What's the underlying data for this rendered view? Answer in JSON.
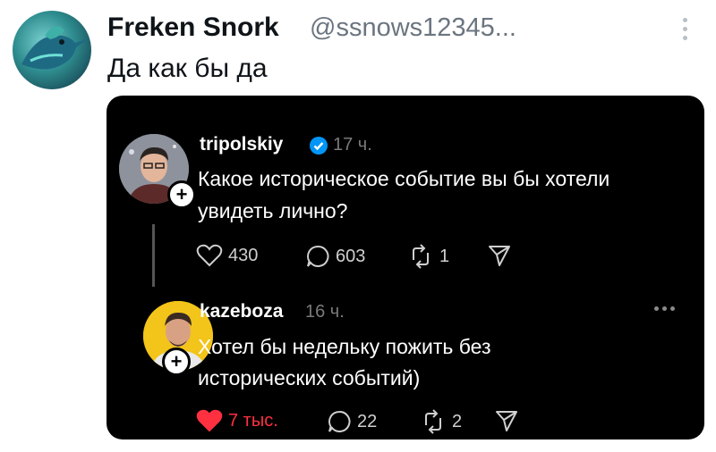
{
  "tweet": {
    "author_name": "Freken Snork",
    "author_handle": "@ssnows12345...",
    "text": "Да как бы да",
    "avatar_icon": "hummingbird-avatar"
  },
  "embedded": {
    "post1": {
      "username": "tripolskiy",
      "time": "17 ч.",
      "text_line1": "Какое историческое событие вы бы хотели",
      "text_line2": "увидеть лично?",
      "likes": "430",
      "comments": "603",
      "reposts": "1"
    },
    "post2": {
      "username": "kazeboza",
      "time": "16 ч.",
      "text_line1": "Хотел бы недельку пожить без",
      "text_line2": "исторических событий)",
      "likes": "7 тыс.",
      "comments": "22",
      "reposts": "2"
    }
  },
  "colors": {
    "like_active": "#ff3040",
    "verified": "#0095f6"
  }
}
